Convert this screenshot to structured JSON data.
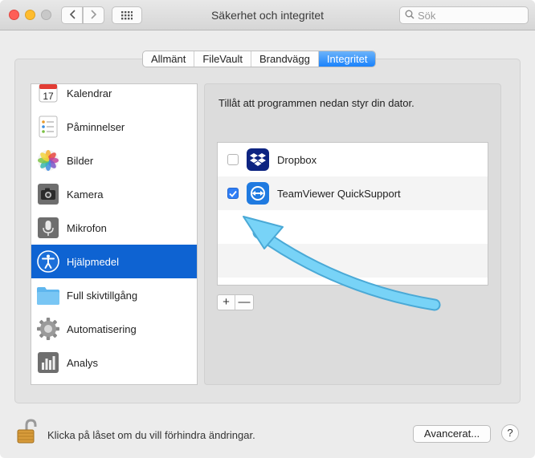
{
  "window": {
    "title": "Säkerhet och integritet"
  },
  "titlebar": {
    "back_icon": "chevron-left-icon",
    "forward_icon": "chevron-right-icon",
    "grid_icon": "grid-icon"
  },
  "search": {
    "placeholder": "Sök"
  },
  "tabs": [
    {
      "label": "Allmänt"
    },
    {
      "label": "FileVault"
    },
    {
      "label": "Brandvägg"
    },
    {
      "label": "Integritet",
      "active": true
    }
  ],
  "sidebar": {
    "items": [
      {
        "label": "Kalendrar",
        "icon": "calendar-icon"
      },
      {
        "label": "Påminnelser",
        "icon": "reminders-icon"
      },
      {
        "label": "Bilder",
        "icon": "photos-icon"
      },
      {
        "label": "Kamera",
        "icon": "camera-icon"
      },
      {
        "label": "Mikrofon",
        "icon": "microphone-icon"
      },
      {
        "label": "Hjälpmedel",
        "icon": "accessibility-icon",
        "selected": true
      },
      {
        "label": "Full skivtillgång",
        "icon": "folder-icon"
      },
      {
        "label": "Automatisering",
        "icon": "gear-icon"
      },
      {
        "label": "Analys",
        "icon": "analytics-icon"
      }
    ],
    "calendar_day": "17"
  },
  "main": {
    "instruction": "Tillåt att programmen nedan styr din dator.",
    "apps": [
      {
        "name": "Dropbox",
        "checked": false,
        "icon": "dropbox-icon"
      },
      {
        "name": "TeamViewer QuickSupport",
        "checked": true,
        "icon": "teamviewer-icon"
      }
    ],
    "add_label": "+",
    "remove_label": "—"
  },
  "footer": {
    "lock_message": "Klicka på låset om du vill förhindra ändringar.",
    "advanced_label": "Avancerat...",
    "help_label": "?"
  },
  "colors": {
    "accent": "#1a82fb",
    "selection": "#0e63d2",
    "annotation_arrow": "#5ec4f2"
  }
}
